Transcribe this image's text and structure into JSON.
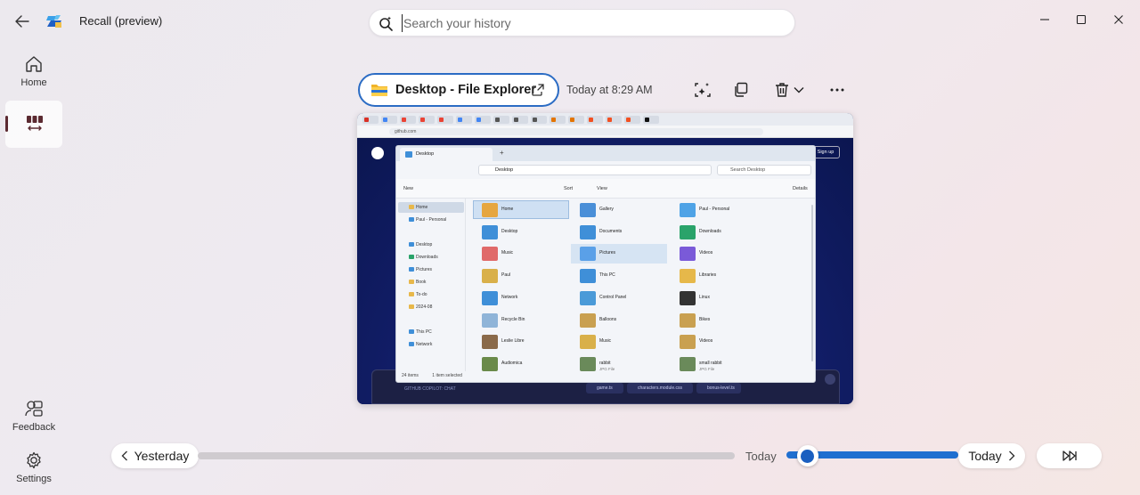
{
  "app": {
    "title": "Recall (preview)",
    "search_placeholder": "Search your history"
  },
  "nav": {
    "home_label": "Home",
    "feedback_label": "Feedback",
    "settings_label": "Settings"
  },
  "snapshot": {
    "window_title": "Desktop - File Explorer",
    "timestamp": "Today at 8:29 AM",
    "browser_url": "github.com",
    "github_signup": "Sign up",
    "github_copilot_text": "GITHUB COPILOT: CHAT",
    "github_files": [
      "game.ts",
      "characters.module.css",
      "bonus-level.ts"
    ],
    "explorer": {
      "tab": "Desktop",
      "path": "Desktop",
      "search": "Search Desktop",
      "toolbar": {
        "new": "New",
        "sort": "Sort",
        "view": "View",
        "details": "Details"
      },
      "sidebar": [
        "Home",
        "Paul - Personal",
        "Desktop",
        "Downloads",
        "Pictures",
        "Book",
        "To-do",
        "2024-08",
        "This PC",
        "Network"
      ],
      "status": [
        "24 items",
        "1 item selected"
      ],
      "items": [
        {
          "name": "Home",
          "sub": ""
        },
        {
          "name": "Gallery",
          "sub": ""
        },
        {
          "name": "Paul - Personal",
          "sub": ""
        },
        {
          "name": "Desktop",
          "sub": ""
        },
        {
          "name": "Documents",
          "sub": ""
        },
        {
          "name": "Downloads",
          "sub": ""
        },
        {
          "name": "Music",
          "sub": ""
        },
        {
          "name": "Pictures",
          "sub": ""
        },
        {
          "name": "Videos",
          "sub": ""
        },
        {
          "name": "Paul",
          "sub": ""
        },
        {
          "name": "This PC",
          "sub": ""
        },
        {
          "name": "Libraries",
          "sub": ""
        },
        {
          "name": "Network",
          "sub": ""
        },
        {
          "name": "Control Panel",
          "sub": ""
        },
        {
          "name": "Linux",
          "sub": ""
        },
        {
          "name": "Recycle Bin",
          "sub": ""
        },
        {
          "name": "Balloons",
          "sub": ""
        },
        {
          "name": "Bikes",
          "sub": ""
        },
        {
          "name": "Leslie Libre",
          "sub": ""
        },
        {
          "name": "Music",
          "sub": ""
        },
        {
          "name": "Videos",
          "sub": ""
        },
        {
          "name": "Audiomica",
          "sub": ""
        },
        {
          "name": "rabbit",
          "sub": "JPG File"
        },
        {
          "name": "small rabbit",
          "sub": "JPG File"
        }
      ]
    }
  },
  "timeline": {
    "prev_label": "Yesterday",
    "current_label": "Today",
    "next_label": "Today",
    "position": 0.06
  },
  "colors": {
    "accent": "#1f6fd0",
    "chip_border": "#2b6cc4",
    "nav_indicator": "#5b2a31"
  }
}
